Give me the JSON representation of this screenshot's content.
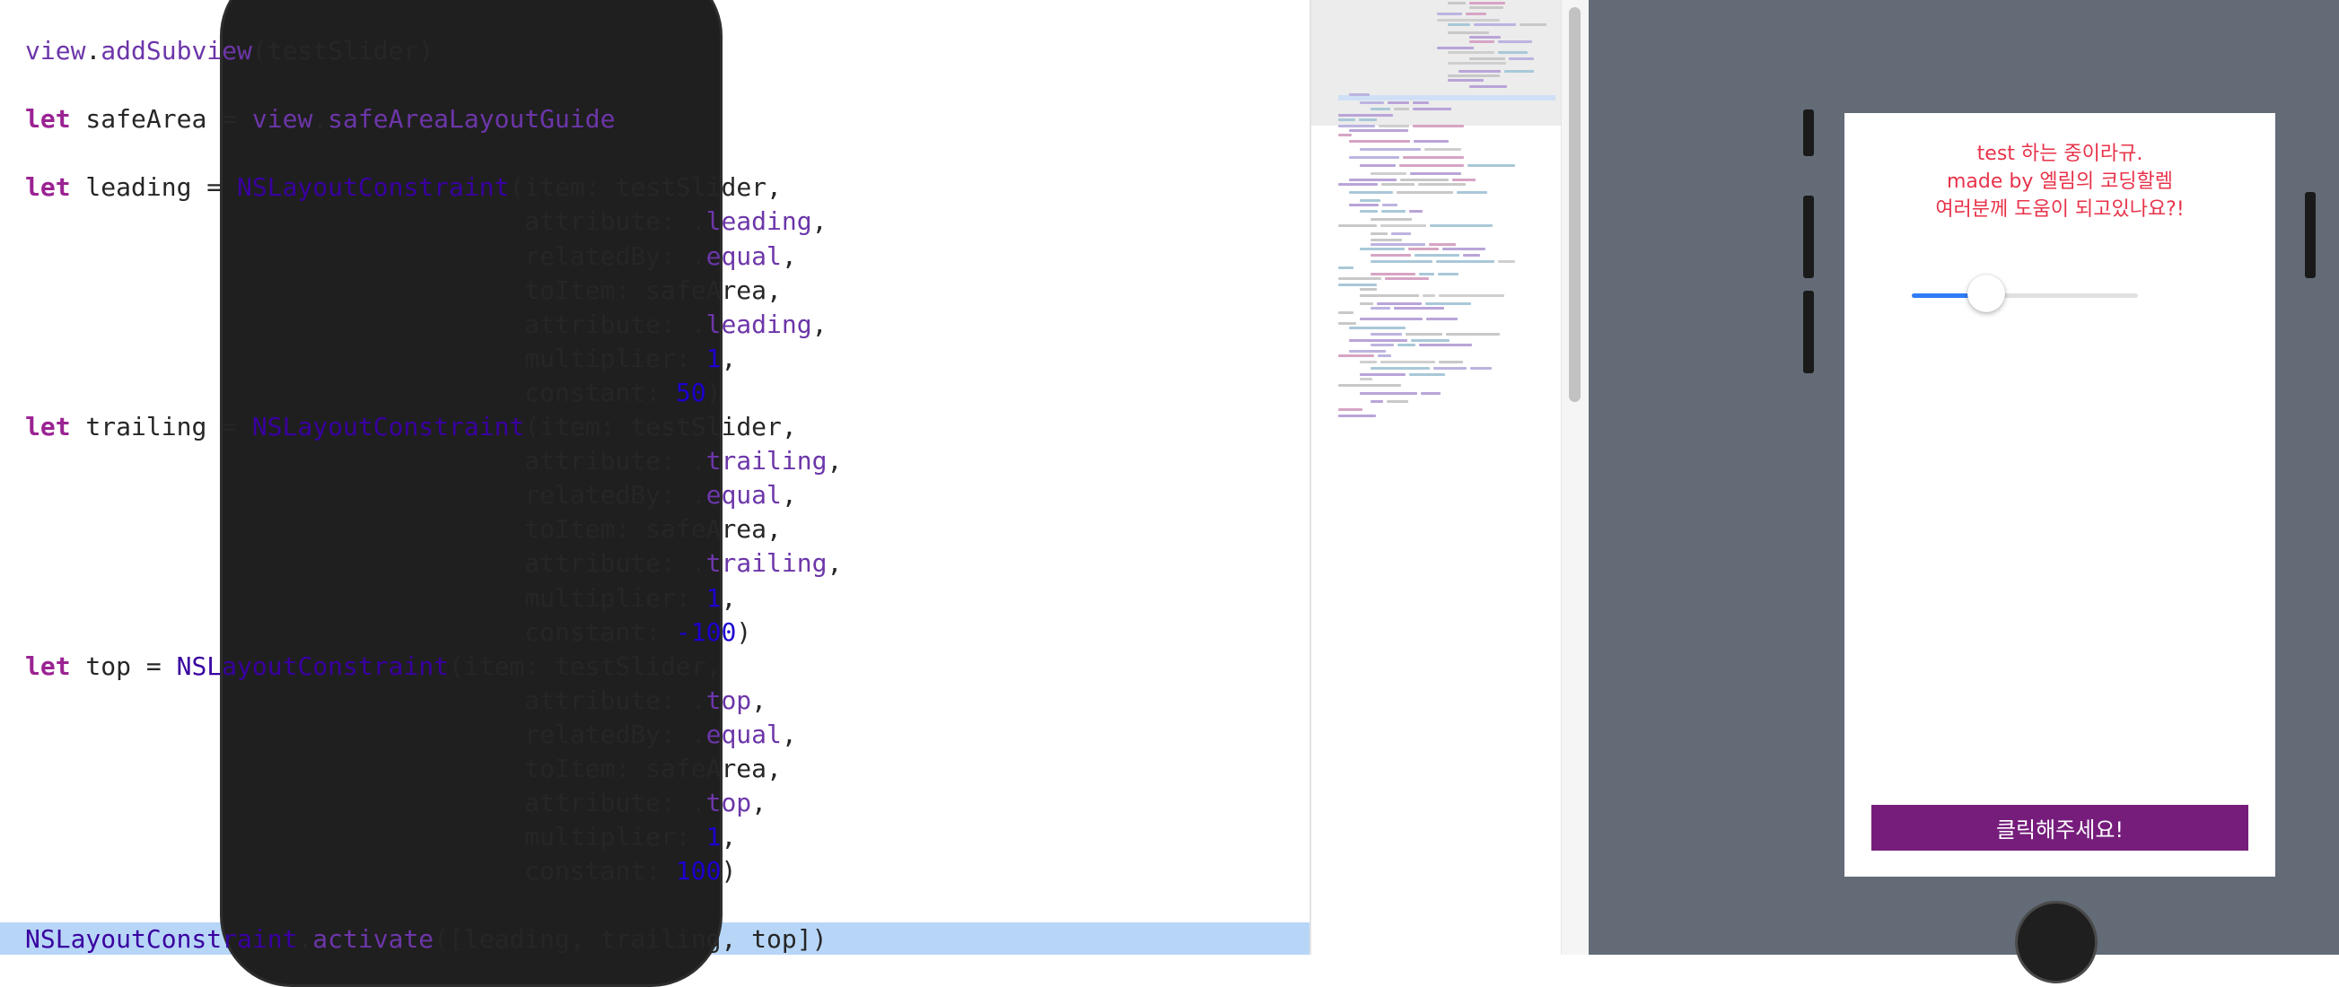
{
  "editor": {
    "lines": [
      [
        {
          "t": "view",
          "c": "fn"
        },
        {
          "t": ".",
          "c": "plain"
        },
        {
          "t": "addSubview",
          "c": "fn"
        },
        {
          "t": "(testSlider)",
          "c": "plain"
        }
      ],
      [],
      [
        {
          "t": "let",
          "c": "kw"
        },
        {
          "t": " safeArea = ",
          "c": "plain"
        },
        {
          "t": "view",
          "c": "fn"
        },
        {
          "t": ".",
          "c": "plain"
        },
        {
          "t": "safeAreaLayoutGuide",
          "c": "fn"
        }
      ],
      [],
      [
        {
          "t": "let",
          "c": "kw"
        },
        {
          "t": " leading = ",
          "c": "plain"
        },
        {
          "t": "NSLayoutConstraint",
          "c": "ty"
        },
        {
          "t": "(item: testSlider,",
          "c": "plain"
        }
      ],
      [
        {
          "t": "                                 attribute: .",
          "c": "plain"
        },
        {
          "t": "leading",
          "c": "fn"
        },
        {
          "t": ",",
          "c": "plain"
        }
      ],
      [
        {
          "t": "                                 relatedBy: .",
          "c": "plain"
        },
        {
          "t": "equal",
          "c": "fn"
        },
        {
          "t": ",",
          "c": "plain"
        }
      ],
      [
        {
          "t": "                                 toItem: safeArea,",
          "c": "plain"
        }
      ],
      [
        {
          "t": "                                 attribute: .",
          "c": "plain"
        },
        {
          "t": "leading",
          "c": "fn"
        },
        {
          "t": ",",
          "c": "plain"
        }
      ],
      [
        {
          "t": "                                 multiplier: ",
          "c": "plain"
        },
        {
          "t": "1",
          "c": "num"
        },
        {
          "t": ",",
          "c": "plain"
        }
      ],
      [
        {
          "t": "                                 constant: ",
          "c": "plain"
        },
        {
          "t": "50",
          "c": "num"
        },
        {
          "t": ")",
          "c": "plain"
        }
      ],
      [
        {
          "t": "let",
          "c": "kw"
        },
        {
          "t": " trailing = ",
          "c": "plain"
        },
        {
          "t": "NSLayoutConstraint",
          "c": "ty"
        },
        {
          "t": "(item: testSlider,",
          "c": "plain"
        }
      ],
      [
        {
          "t": "                                 attribute: .",
          "c": "plain"
        },
        {
          "t": "trailing",
          "c": "fn"
        },
        {
          "t": ",",
          "c": "plain"
        }
      ],
      [
        {
          "t": "                                 relatedBy: .",
          "c": "plain"
        },
        {
          "t": "equal",
          "c": "fn"
        },
        {
          "t": ",",
          "c": "plain"
        }
      ],
      [
        {
          "t": "                                 toItem: safeArea,",
          "c": "plain"
        }
      ],
      [
        {
          "t": "                                 attribute: .",
          "c": "plain"
        },
        {
          "t": "trailing",
          "c": "fn"
        },
        {
          "t": ",",
          "c": "plain"
        }
      ],
      [
        {
          "t": "                                 multiplier: ",
          "c": "plain"
        },
        {
          "t": "1",
          "c": "num"
        },
        {
          "t": ",",
          "c": "plain"
        }
      ],
      [
        {
          "t": "                                 constant: ",
          "c": "plain"
        },
        {
          "t": "-100",
          "c": "num"
        },
        {
          "t": ")",
          "c": "plain"
        }
      ],
      [
        {
          "t": "let",
          "c": "kw"
        },
        {
          "t": " top = ",
          "c": "plain"
        },
        {
          "t": "NSLayoutConstraint",
          "c": "ty"
        },
        {
          "t": "(item: testSlider,",
          "c": "plain"
        }
      ],
      [
        {
          "t": "                                 attribute: .",
          "c": "plain"
        },
        {
          "t": "top",
          "c": "fn"
        },
        {
          "t": ",",
          "c": "plain"
        }
      ],
      [
        {
          "t": "                                 relatedBy: .",
          "c": "plain"
        },
        {
          "t": "equal",
          "c": "fn"
        },
        {
          "t": ",",
          "c": "plain"
        }
      ],
      [
        {
          "t": "                                 toItem: safeArea,",
          "c": "plain"
        }
      ],
      [
        {
          "t": "                                 attribute: .",
          "c": "plain"
        },
        {
          "t": "top",
          "c": "fn"
        },
        {
          "t": ",",
          "c": "plain"
        }
      ],
      [
        {
          "t": "                                 multiplier: ",
          "c": "plain"
        },
        {
          "t": "1",
          "c": "num"
        },
        {
          "t": ",",
          "c": "plain"
        }
      ],
      [
        {
          "t": "                                 constant: ",
          "c": "plain"
        },
        {
          "t": "100",
          "c": "num"
        },
        {
          "t": ")",
          "c": "plain"
        }
      ],
      [],
      [
        {
          "t": "NSLayoutConstraint",
          "c": "ty"
        },
        {
          "t": ".",
          "c": "plain"
        },
        {
          "t": "activate",
          "c": "fn"
        },
        {
          "t": "([leading, trailing, top])",
          "c": "plain"
        }
      ]
    ],
    "highlighted_line": 26
  },
  "simulator": {
    "screen_text": {
      "line1": "test 하는 중이라규.",
      "line2": "made by 엘림의 코딩할렘",
      "line3": "여러분께 도움이 되고있나요?!"
    },
    "slider": {
      "value": 0.33,
      "track_color": "#e1e1e1",
      "fill_color": "#2f7cf6"
    },
    "button": {
      "label": "클릭해주세요!",
      "color": "#761d7c"
    }
  },
  "colors": {
    "keyword": "#9b2393",
    "function": "#6c36a9",
    "type": "#3900a0",
    "number": "#1c00cf",
    "line_highlight": "#b7d6f7",
    "simulator_background": "#636b77",
    "screen_text": "#e8334a"
  }
}
